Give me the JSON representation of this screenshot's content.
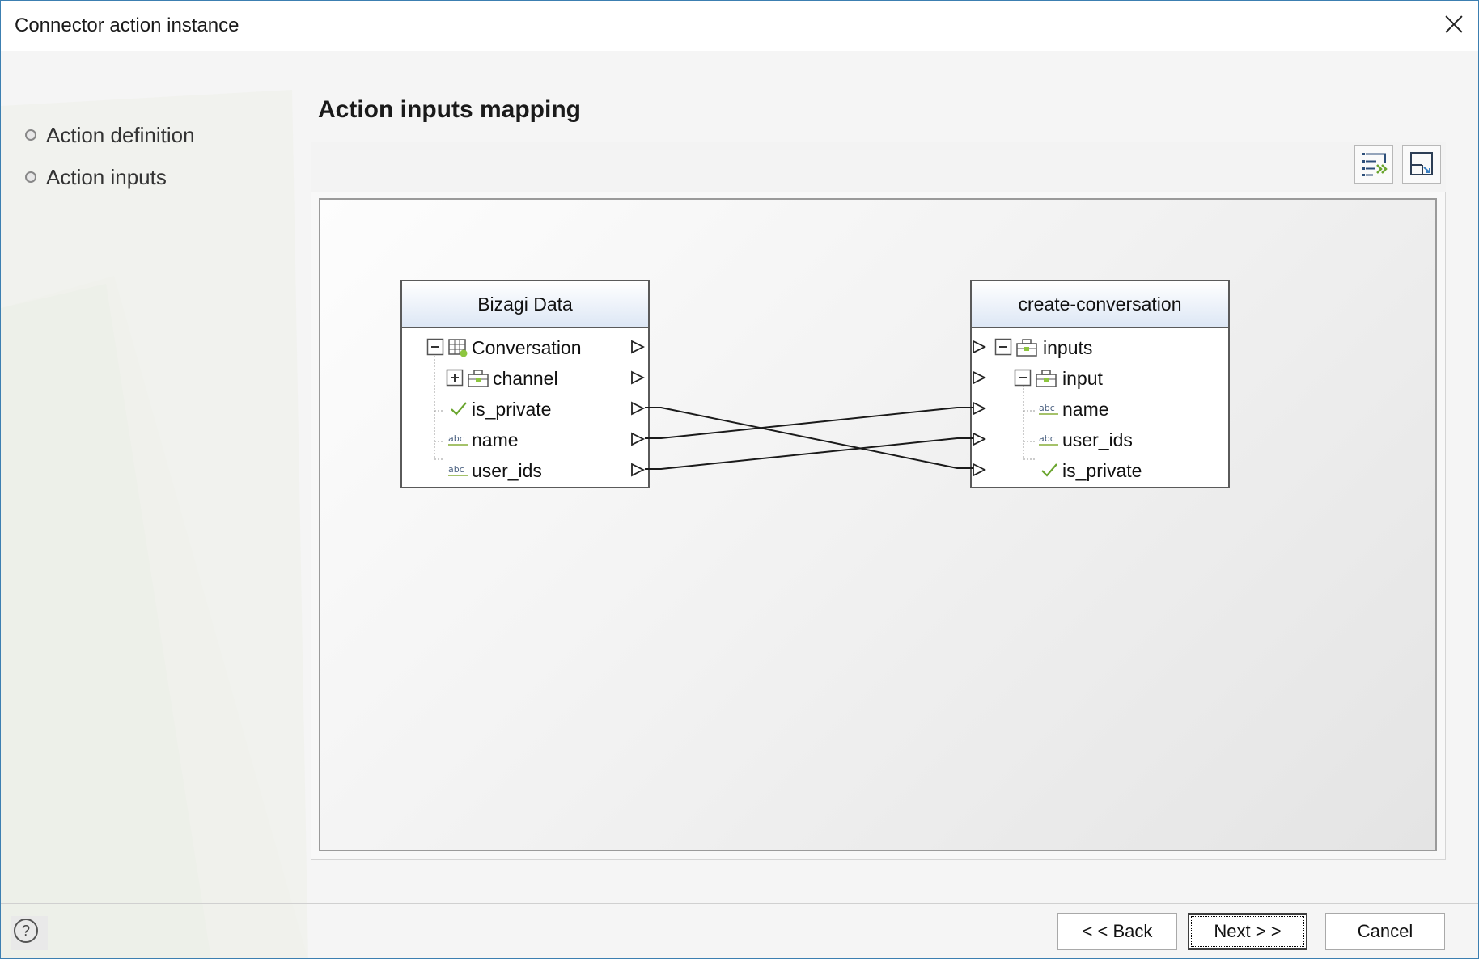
{
  "window": {
    "title": "Connector action instance"
  },
  "nav": {
    "items": [
      {
        "label": "Action definition"
      },
      {
        "label": "Action inputs"
      }
    ]
  },
  "section": {
    "title": "Action inputs mapping"
  },
  "toolbar": {
    "icons": [
      "auto-map-icon",
      "fit-view-icon"
    ]
  },
  "source": {
    "title": "Bizagi Data",
    "rows": [
      {
        "label": "Conversation",
        "icon": "entity-table-icon",
        "toggle": "collapse"
      },
      {
        "label": "channel",
        "icon": "briefcase-icon",
        "toggle": "expand"
      },
      {
        "label": "is_private",
        "icon": "boolean-check-icon"
      },
      {
        "label": "name",
        "icon": "string-abc-icon"
      },
      {
        "label": "user_ids",
        "icon": "string-abc-icon"
      }
    ]
  },
  "target": {
    "title": "create-conversation",
    "rows": [
      {
        "label": "inputs",
        "icon": "briefcase-icon",
        "toggle": "collapse"
      },
      {
        "label": "input",
        "icon": "briefcase-icon",
        "toggle": "collapse"
      },
      {
        "label": "name",
        "icon": "string-abc-icon"
      },
      {
        "label": "user_ids",
        "icon": "string-abc-icon"
      },
      {
        "label": "is_private",
        "icon": "boolean-check-icon"
      }
    ]
  },
  "mappings": [
    {
      "from": "is_private",
      "to": "is_private"
    },
    {
      "from": "name",
      "to": "name"
    },
    {
      "from": "user_ids",
      "to": "user_ids"
    }
  ],
  "footer": {
    "help_symbol": "?",
    "back_label": "< < Back",
    "next_label": "Next > >",
    "cancel_label": "Cancel"
  },
  "colors": {
    "window_border": "#3c7fb1",
    "check_green": "#6aa52e",
    "abc_underline": "#a5c26a"
  }
}
